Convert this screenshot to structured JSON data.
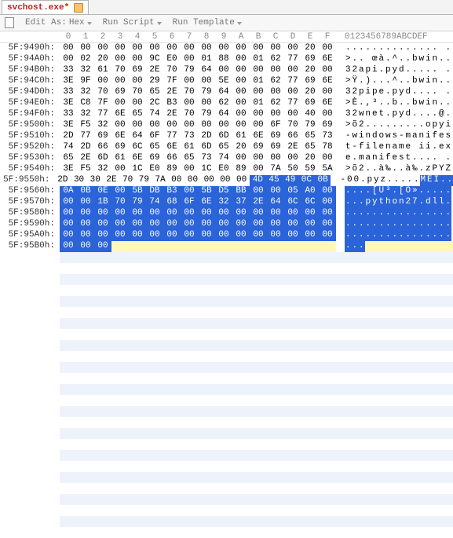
{
  "tab": {
    "title": "svchost.exe*"
  },
  "toolbar": {
    "edit_as": "Edit As:",
    "edit_as_value": "Hex",
    "run_script": "Run Script",
    "run_template": "Run Template"
  },
  "header": {
    "hex_cols": [
      "0",
      "1",
      "2",
      "3",
      "4",
      "5",
      "6",
      "7",
      "8",
      "9",
      "A",
      "B",
      "C",
      "D",
      "E",
      "F"
    ],
    "ascii_header": "0123456789ABCDEF"
  },
  "hex_rows": [
    {
      "addr": "5F:9490h:",
      "bytes": [
        "00",
        "00",
        "00",
        "00",
        "00",
        "00",
        "00",
        "00",
        "00",
        "00",
        "00",
        "00",
        "00",
        "00",
        "20",
        "00"
      ],
      "ascii": [
        ".",
        ".",
        ".",
        ".",
        ".",
        ".",
        ".",
        ".",
        ".",
        ".",
        ".",
        ".",
        ".",
        ".",
        " ",
        "."
      ]
    },
    {
      "addr": "5F:94A0h:",
      "bytes": [
        "00",
        "02",
        "20",
        "00",
        "00",
        "9C",
        "E0",
        "00",
        "01",
        "88",
        "00",
        "01",
        "62",
        "77",
        "69",
        "6E"
      ],
      "ascii": [
        ">",
        ".",
        ".",
        " ",
        "œ",
        "à",
        ".",
        "^",
        ".",
        ".",
        "b",
        "w",
        "i",
        "n",
        ".",
        "."
      ]
    },
    {
      "addr": "5F:94B0h:",
      "bytes": [
        "33",
        "32",
        "61",
        "70",
        "69",
        "2E",
        "70",
        "79",
        "64",
        "00",
        "00",
        "00",
        "00",
        "00",
        "20",
        "00"
      ],
      "ascii": [
        "3",
        "2",
        "a",
        "p",
        "i",
        ".",
        "p",
        "y",
        "d",
        ".",
        ".",
        ".",
        ".",
        ".",
        " ",
        "."
      ]
    },
    {
      "addr": "5F:94C0h:",
      "bytes": [
        "3E",
        "9F",
        "00",
        "00",
        "00",
        "29",
        "7F",
        "00",
        "00",
        "5E",
        "00",
        "01",
        "62",
        "77",
        "69",
        "6E"
      ],
      "ascii": [
        ">",
        "Ÿ",
        ".",
        ")",
        ".",
        ".",
        ".",
        "^",
        ".",
        ".",
        "b",
        "w",
        "i",
        "n",
        ".",
        "."
      ]
    },
    {
      "addr": "5F:94D0h:",
      "bytes": [
        "33",
        "32",
        "70",
        "69",
        "70",
        "65",
        "2E",
        "70",
        "79",
        "64",
        "00",
        "00",
        "00",
        "00",
        "20",
        "00"
      ],
      "ascii": [
        "3",
        "2",
        "p",
        "i",
        "p",
        "e",
        ".",
        "p",
        "y",
        "d",
        ".",
        ".",
        ".",
        ".",
        " ",
        "."
      ]
    },
    {
      "addr": "5F:94E0h:",
      "bytes": [
        "3E",
        "C8",
        "7F",
        "00",
        "00",
        "2C",
        "B3",
        "00",
        "00",
        "62",
        "00",
        "01",
        "62",
        "77",
        "69",
        "6E"
      ],
      "ascii": [
        ">",
        "È",
        ".",
        ",",
        "³",
        ".",
        ".",
        "b",
        ".",
        ".",
        "b",
        "w",
        "i",
        "n",
        ".",
        "."
      ]
    },
    {
      "addr": "5F:94F0h:",
      "bytes": [
        "33",
        "32",
        "77",
        "6E",
        "65",
        "74",
        "2E",
        "70",
        "79",
        "64",
        "00",
        "00",
        "00",
        "00",
        "40",
        "00"
      ],
      "ascii": [
        "3",
        "2",
        "w",
        "n",
        "e",
        "t",
        ".",
        "p",
        "y",
        "d",
        ".",
        ".",
        ".",
        ".",
        "@",
        "."
      ]
    },
    {
      "addr": "5F:9500h:",
      "bytes": [
        "3E",
        "F5",
        "32",
        "00",
        "00",
        "00",
        "00",
        "00",
        "00",
        "00",
        "00",
        "00",
        "6F",
        "70",
        "79",
        "69"
      ],
      "ascii": [
        ">",
        "õ",
        "2",
        ".",
        ".",
        ".",
        ".",
        ".",
        ".",
        ".",
        ".",
        ".",
        "o",
        "p",
        "y",
        "i"
      ]
    },
    {
      "addr": "5F:9510h:",
      "bytes": [
        "2D",
        "77",
        "69",
        "6E",
        "64",
        "6F",
        "77",
        "73",
        "2D",
        "6D",
        "61",
        "6E",
        "69",
        "66",
        "65",
        "73"
      ],
      "ascii": [
        "-",
        "w",
        "i",
        "n",
        "d",
        "o",
        "w",
        "s",
        "-",
        "m",
        "a",
        "n",
        "i",
        "f",
        "e",
        "s"
      ]
    },
    {
      "addr": "5F:9520h:",
      "bytes": [
        "74",
        "2D",
        "66",
        "69",
        "6C",
        "65",
        "6E",
        "61",
        "6D",
        "65",
        "20",
        "69",
        "69",
        "2E",
        "65",
        "78"
      ],
      "ascii": [
        "t",
        "-",
        "f",
        "i",
        "l",
        "e",
        "n",
        "a",
        "m",
        "e",
        " ",
        "i",
        "i",
        ".",
        "e",
        "x"
      ]
    },
    {
      "addr": "5F:9530h:",
      "bytes": [
        "65",
        "2E",
        "6D",
        "61",
        "6E",
        "69",
        "66",
        "65",
        "73",
        "74",
        "00",
        "00",
        "00",
        "00",
        "20",
        "00"
      ],
      "ascii": [
        "e",
        ".",
        "m",
        "a",
        "n",
        "i",
        "f",
        "e",
        "s",
        "t",
        ".",
        ".",
        ".",
        ".",
        " ",
        "."
      ]
    },
    {
      "addr": "5F:9540h:",
      "bytes": [
        "3E",
        "F5",
        "32",
        "00",
        "1C",
        "E0",
        "89",
        "00",
        "1C",
        "E0",
        "89",
        "00",
        "7A",
        "50",
        "59",
        "5A"
      ],
      "ascii": [
        ">",
        "õ",
        "2",
        ".",
        ".",
        "à",
        "‰",
        ".",
        ".",
        "à",
        "‰",
        ".",
        "z",
        "P",
        "Y",
        "Z"
      ]
    },
    {
      "addr": "5F:9550h:",
      "bytes": [
        "2D",
        "30",
        "30",
        "2E",
        "70",
        "79",
        "7A",
        "00",
        "00",
        "00",
        "00",
        "00",
        "4D",
        "45",
        "49",
        "0C"
      ],
      "ascii": [
        "-",
        "0",
        "0",
        ".",
        "p",
        "y",
        "z",
        ".",
        ".",
        ".",
        ".",
        ".",
        "M",
        "E",
        "I",
        "."
      ],
      "sel_bytes": [
        12,
        13,
        14,
        15,
        16
      ],
      "sel_ascii": [
        12,
        13,
        14,
        15
      ],
      "last_byte": "0B",
      "last_ascii": "."
    },
    {
      "addr": "5F:9560h:",
      "bytes": [
        "0A",
        "0B",
        "0E",
        "00",
        "5B",
        "DB",
        "B3",
        "00",
        "5B",
        "D5",
        "BB",
        "00",
        "00",
        "05",
        "A0",
        "00"
      ],
      "ascii": [
        ".",
        ".",
        ".",
        ".",
        "[",
        "Û",
        "³",
        ".",
        "[",
        "Õ",
        "»",
        ".",
        ".",
        ".",
        ".",
        "."
      ],
      "full_sel": true
    },
    {
      "addr": "5F:9570h:",
      "bytes": [
        "00",
        "00",
        "1B",
        "70",
        "79",
        "74",
        "68",
        "6F",
        "6E",
        "32",
        "37",
        "2E",
        "64",
        "6C",
        "6C",
        "00"
      ],
      "ascii": [
        ".",
        ".",
        ".",
        "p",
        "y",
        "t",
        "h",
        "o",
        "n",
        "2",
        "7",
        ".",
        "d",
        "l",
        "l",
        "."
      ],
      "full_sel": true
    },
    {
      "addr": "5F:9580h:",
      "bytes": [
        "00",
        "00",
        "00",
        "00",
        "00",
        "00",
        "00",
        "00",
        "00",
        "00",
        "00",
        "00",
        "00",
        "00",
        "00",
        "00"
      ],
      "ascii": [
        ".",
        ".",
        ".",
        ".",
        ".",
        ".",
        ".",
        ".",
        ".",
        ".",
        ".",
        ".",
        ".",
        ".",
        ".",
        "."
      ],
      "full_sel": true
    },
    {
      "addr": "5F:9590h:",
      "bytes": [
        "00",
        "00",
        "00",
        "00",
        "00",
        "00",
        "00",
        "00",
        "00",
        "00",
        "00",
        "00",
        "00",
        "00",
        "00",
        "00"
      ],
      "ascii": [
        ".",
        ".",
        ".",
        ".",
        ".",
        ".",
        ".",
        ".",
        ".",
        ".",
        ".",
        ".",
        ".",
        ".",
        ".",
        "."
      ],
      "full_sel": true
    },
    {
      "addr": "5F:95A0h:",
      "bytes": [
        "00",
        "00",
        "00",
        "00",
        "00",
        "00",
        "00",
        "00",
        "00",
        "00",
        "00",
        "00",
        "00",
        "00",
        "00",
        "00"
      ],
      "ascii": [
        ".",
        ".",
        ".",
        ".",
        ".",
        ".",
        ".",
        ".",
        ".",
        ".",
        ".",
        ".",
        ".",
        ".",
        ".",
        "."
      ],
      "full_sel": true
    },
    {
      "addr": "5F:95B0h:",
      "bytes": [
        "00",
        "00",
        "00"
      ],
      "ascii": [
        ".",
        ".",
        "."
      ],
      "full_sel": true,
      "caret_after": true
    }
  ],
  "empty_rows": 26
}
